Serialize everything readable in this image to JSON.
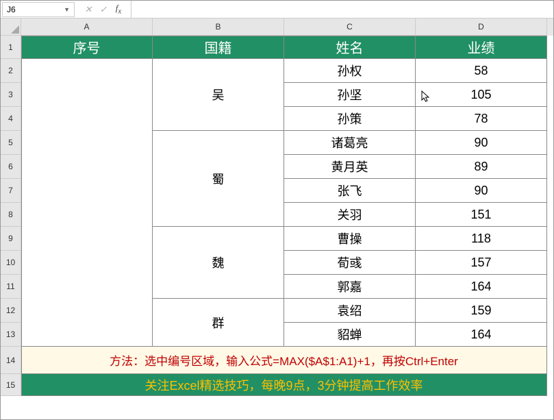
{
  "name_box": "J6",
  "formula_input": "",
  "col_labels": [
    "A",
    "B",
    "C",
    "D"
  ],
  "row_labels": [
    "1",
    "2",
    "3",
    "4",
    "5",
    "6",
    "7",
    "8",
    "9",
    "10",
    "11",
    "12",
    "13",
    "14",
    "15"
  ],
  "headers": {
    "A": "序号",
    "B": "国籍",
    "C": "姓名",
    "D": "业绩"
  },
  "b_merged": [
    {
      "label": "吴",
      "rows": "2-4"
    },
    {
      "label": "蜀",
      "rows": "5-8"
    },
    {
      "label": "魏",
      "rows": "9-11"
    },
    {
      "label": "群",
      "rows": "12-13"
    }
  ],
  "rows": [
    {
      "c": "孙权",
      "d": "58"
    },
    {
      "c": "孙坚",
      "d": "105"
    },
    {
      "c": "孙策",
      "d": "78"
    },
    {
      "c": "诸葛亮",
      "d": "90"
    },
    {
      "c": "黄月英",
      "d": "89"
    },
    {
      "c": "张飞",
      "d": "90"
    },
    {
      "c": "关羽",
      "d": "151"
    },
    {
      "c": "曹操",
      "d": "118"
    },
    {
      "c": "荀彧",
      "d": "157"
    },
    {
      "c": "郭嘉",
      "d": "164"
    },
    {
      "c": "袁绍",
      "d": "159"
    },
    {
      "c": "貂蝉",
      "d": "164"
    }
  ],
  "note1": "方法：选中编号区域，输入公式=MAX($A$1:A1)+1，再按Ctrl+Enter",
  "note2": "关注Excel精选技巧，每晚9点，3分钟提高工作效率"
}
